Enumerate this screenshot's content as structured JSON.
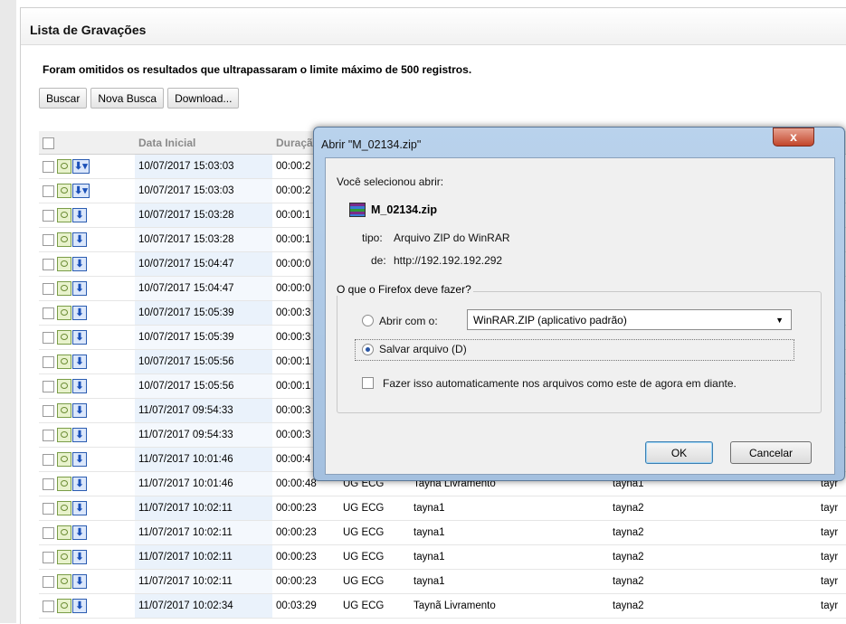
{
  "panel": {
    "title": "Lista de Gravações",
    "notice": "Foram omitidos os resultados que ultrapassaram o limite máximo de 500 registros."
  },
  "toolbar": {
    "search_label": "Buscar",
    "new_search_label": "Nova Busca",
    "download_label": "Download..."
  },
  "table": {
    "headers": [
      "Data Inicial",
      "Duraçã"
    ],
    "rows": [
      {
        "date": "10/07/2017 15:03:03",
        "dur": "00:00:2",
        "c3": "",
        "c4": "",
        "c5": "",
        "c6": ""
      },
      {
        "date": "10/07/2017 15:03:03",
        "dur": "00:00:2",
        "c3": "",
        "c4": "",
        "c5": "",
        "c6": ""
      },
      {
        "date": "10/07/2017 15:03:28",
        "dur": "00:00:1",
        "c3": "",
        "c4": "",
        "c5": "",
        "c6": ""
      },
      {
        "date": "10/07/2017 15:03:28",
        "dur": "00:00:1",
        "c3": "",
        "c4": "",
        "c5": "",
        "c6": ""
      },
      {
        "date": "10/07/2017 15:04:47",
        "dur": "00:00:0",
        "c3": "",
        "c4": "",
        "c5": "",
        "c6": ""
      },
      {
        "date": "10/07/2017 15:04:47",
        "dur": "00:00:0",
        "c3": "",
        "c4": "",
        "c5": "",
        "c6": ""
      },
      {
        "date": "10/07/2017 15:05:39",
        "dur": "00:00:3",
        "c3": "",
        "c4": "",
        "c5": "",
        "c6": ""
      },
      {
        "date": "10/07/2017 15:05:39",
        "dur": "00:00:3",
        "c3": "",
        "c4": "",
        "c5": "",
        "c6": ""
      },
      {
        "date": "10/07/2017 15:05:56",
        "dur": "00:00:1",
        "c3": "",
        "c4": "",
        "c5": "",
        "c6": ""
      },
      {
        "date": "10/07/2017 15:05:56",
        "dur": "00:00:1",
        "c3": "",
        "c4": "",
        "c5": "",
        "c6": ""
      },
      {
        "date": "11/07/2017 09:54:33",
        "dur": "00:00:3",
        "c3": "",
        "c4": "",
        "c5": "",
        "c6": ""
      },
      {
        "date": "11/07/2017 09:54:33",
        "dur": "00:00:3",
        "c3": "",
        "c4": "",
        "c5": "",
        "c6": ""
      },
      {
        "date": "11/07/2017 10:01:46",
        "dur": "00:00:4",
        "c3": "",
        "c4": "",
        "c5": "",
        "c6": ""
      },
      {
        "date": "11/07/2017 10:01:46",
        "dur": "00:00:48",
        "c3": "UG ECG",
        "c4": "Tayna Livramento",
        "c5": "tayna1",
        "c6": "tayr"
      },
      {
        "date": "11/07/2017 10:02:11",
        "dur": "00:00:23",
        "c3": "UG ECG",
        "c4": "tayna1",
        "c5": "tayna2",
        "c6": "tayr"
      },
      {
        "date": "11/07/2017 10:02:11",
        "dur": "00:00:23",
        "c3": "UG ECG",
        "c4": "tayna1",
        "c5": "tayna2",
        "c6": "tayr"
      },
      {
        "date": "11/07/2017 10:02:11",
        "dur": "00:00:23",
        "c3": "UG ECG",
        "c4": "tayna1",
        "c5": "tayna2",
        "c6": "tayr"
      },
      {
        "date": "11/07/2017 10:02:11",
        "dur": "00:00:23",
        "c3": "UG ECG",
        "c4": "tayna1",
        "c5": "tayna2",
        "c6": "tayr"
      },
      {
        "date": "11/07/2017 10:02:34",
        "dur": "00:03:29",
        "c3": "UG ECG",
        "c4": "Taynã Livramento",
        "c5": "tayna2",
        "c6": "tayr"
      }
    ]
  },
  "dialog": {
    "title": "Abrir \"M_02134.zip\"",
    "close_glyph": "x",
    "intro": "Você selecionou abrir:",
    "file_name": "M_02134.zip",
    "type_label": "tipo:",
    "type_value": "Arquivo ZIP do WinRAR",
    "from_label": "de:",
    "from_value": "http://192.192.192.292",
    "question": "O que o Firefox deve fazer?",
    "open_with_label": "Abrir com o:",
    "open_with_app": "WinRAR.ZIP (aplicativo padrão)",
    "save_label": "Salvar arquivo (D)",
    "auto_label": "Fazer isso automaticamente nos arquivos como este de agora em diante.",
    "ok_label": "OK",
    "cancel_label": "Cancelar"
  }
}
